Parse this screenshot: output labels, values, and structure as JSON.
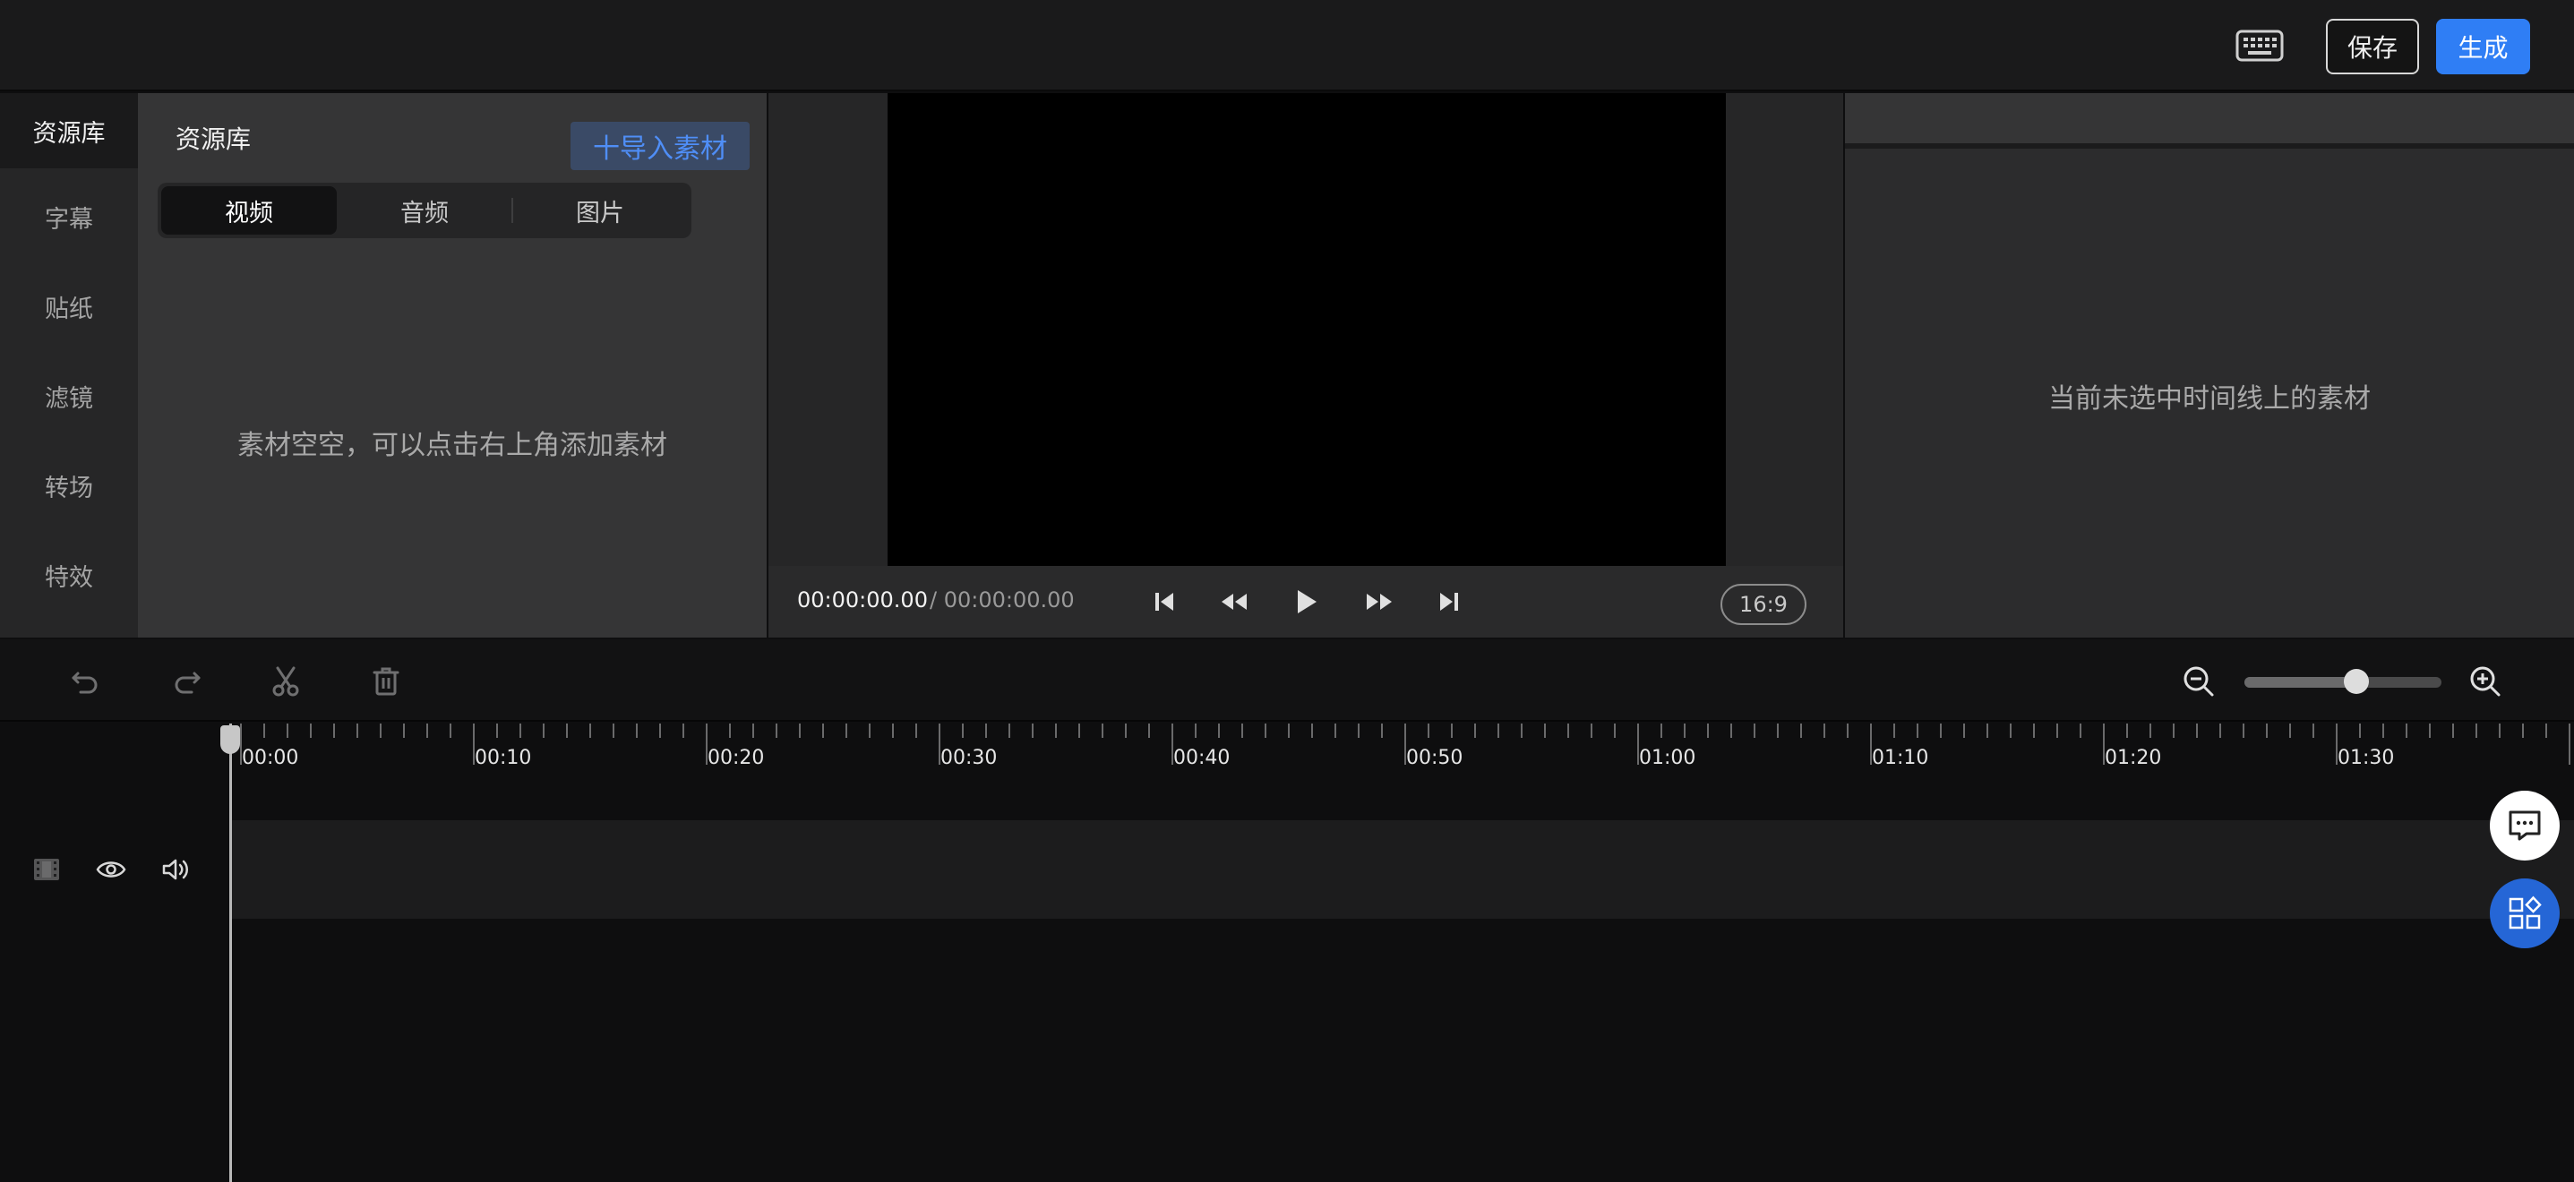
{
  "topbar": {
    "keyboard_icon": "keyboard-icon",
    "save_label": "保存",
    "generate_label": "生成",
    "accent_color": "#2f7ef5"
  },
  "sidebar": {
    "items": [
      {
        "label": "资源库",
        "active": true
      },
      {
        "label": "字幕"
      },
      {
        "label": "贴纸"
      },
      {
        "label": "滤镜"
      },
      {
        "label": "转场"
      },
      {
        "label": "特效"
      }
    ]
  },
  "library": {
    "title": "资源库",
    "import_label": "十导入素材",
    "tabs": [
      {
        "label": "视频",
        "active": true
      },
      {
        "label": "音频"
      },
      {
        "label": "图片"
      }
    ],
    "empty_message": "素材空空，可以点击右上角添加素材"
  },
  "preview": {
    "current_time": "00:00:00.00",
    "total_time": "/ 00:00:00.00",
    "aspect_ratio": "16:9",
    "controls": [
      "skip-start-icon",
      "rewind-icon",
      "play-icon",
      "fast-forward-icon",
      "skip-end-icon"
    ]
  },
  "properties": {
    "empty_message": "当前未选中时间线上的素材"
  },
  "timeline": {
    "tools": [
      "undo-icon",
      "redo-icon",
      "cut-icon",
      "delete-icon"
    ],
    "zoom_level": 0.57,
    "ruler_labels": [
      "00:00",
      "00:10",
      "00:20",
      "00:30",
      "00:40",
      "00:50",
      "01:00",
      "01:10",
      "01:20",
      "01:30"
    ],
    "track_icons": [
      "film-icon",
      "eye-icon",
      "volume-icon"
    ]
  },
  "floating": {
    "chat_icon": "chat-icon",
    "apps_icon": "apps-icon"
  }
}
